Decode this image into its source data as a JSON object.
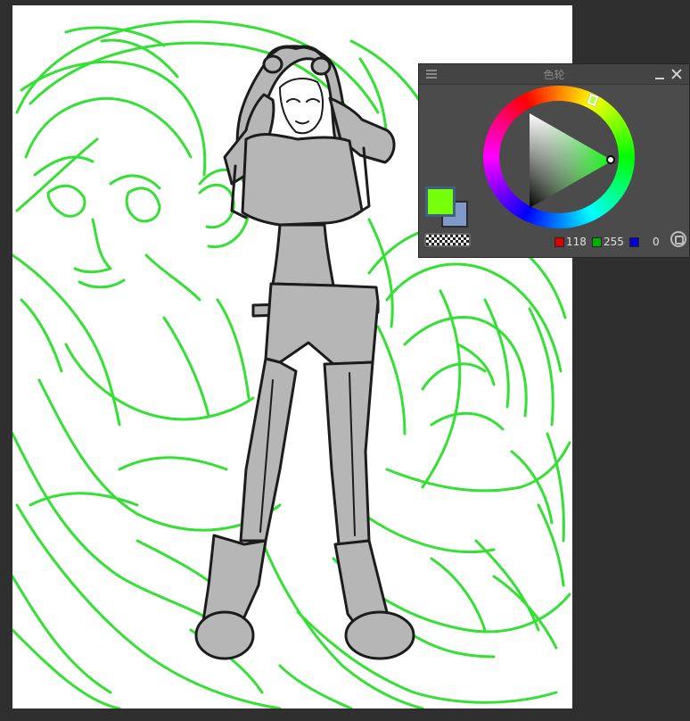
{
  "color_wheel_panel": {
    "title": "色轮",
    "menu_icon": "menu-icon",
    "minimize_icon": "minimize-icon",
    "close_icon": "close-icon",
    "hue_color": "#00ff00",
    "foreground_color": "#76ff0a",
    "background_color": "#7f9ac8",
    "rgb": {
      "red": "118",
      "green": "255",
      "blue": "0"
    },
    "settings_icon": "panel-settings-icon"
  },
  "canvas": {
    "background": "#ffffff",
    "sketch_color": "#35e035",
    "lineart_color": "#1c1c1c",
    "fill_color": "#b6b6b6"
  }
}
